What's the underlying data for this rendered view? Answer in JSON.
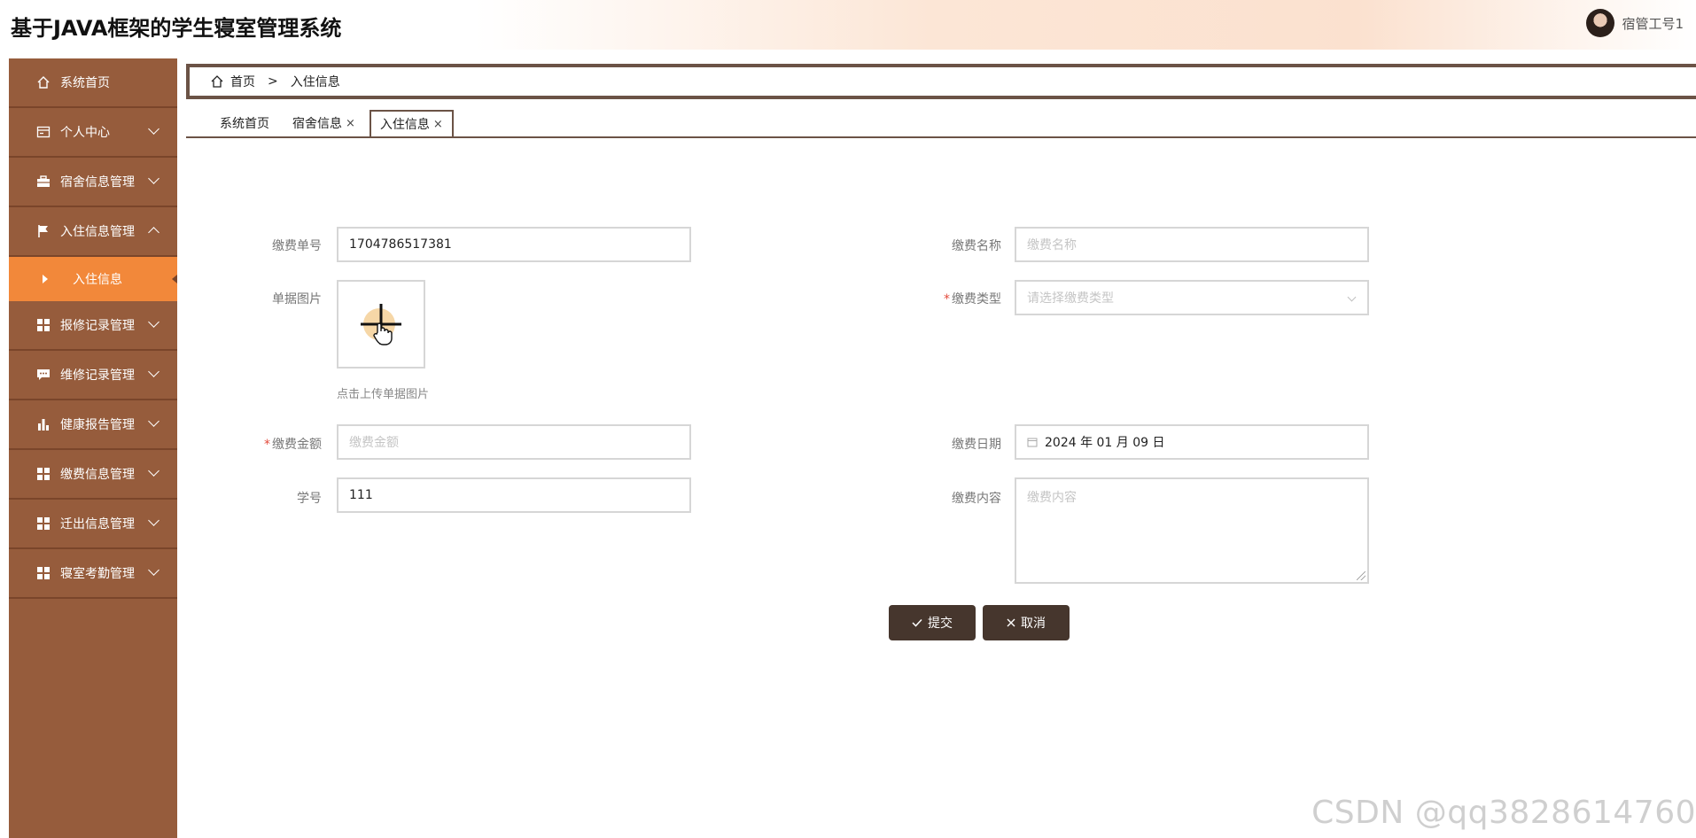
{
  "header": {
    "title": "基于JAVA框架的学生寝室管理系统",
    "user_name": "宿管工号1"
  },
  "sidebar": {
    "items": [
      {
        "label": "系统首页",
        "icon": "home-icon"
      },
      {
        "label": "个人中心",
        "icon": "id-card-icon"
      },
      {
        "label": "宿舍信息管理",
        "icon": "briefcase-icon"
      },
      {
        "label": "入住信息管理",
        "icon": "flag-icon"
      },
      {
        "label": "报修记录管理",
        "icon": "grid-icon"
      },
      {
        "label": "维修记录管理",
        "icon": "chat-icon"
      },
      {
        "label": "健康报告管理",
        "icon": "bar-chart-icon"
      },
      {
        "label": "缴费信息管理",
        "icon": "grid-icon"
      },
      {
        "label": "迁出信息管理",
        "icon": "grid-icon"
      },
      {
        "label": "寝室考勤管理",
        "icon": "grid-icon"
      }
    ],
    "sub_item": "入住信息"
  },
  "breadcrumb": {
    "home": "首页",
    "sep": ">",
    "current": "入住信息"
  },
  "tabs": [
    {
      "label": "系统首页"
    },
    {
      "label": "宿舍信息",
      "close": "×"
    },
    {
      "label": "入住信息",
      "close": "×"
    }
  ],
  "form": {
    "order_no": {
      "label": "缴费单号",
      "value": "1704786517381"
    },
    "fee_name": {
      "label": "缴费名称",
      "placeholder": "缴费名称"
    },
    "receipt_image": {
      "label": "单据图片",
      "hint": "点击上传单据图片"
    },
    "fee_type": {
      "label": "缴费类型",
      "placeholder": "请选择缴费类型",
      "required": "*"
    },
    "amount": {
      "label": "缴费金额",
      "placeholder": "缴费金额",
      "required": "*"
    },
    "fee_date": {
      "label": "缴费日期",
      "value": "2024 年 01 月 09 日"
    },
    "student_no": {
      "label": "学号",
      "value": "111"
    },
    "fee_content": {
      "label": "缴费内容",
      "placeholder": "缴费内容"
    },
    "submit_label": "提交",
    "cancel_label": "取消"
  },
  "watermark": "CSDN @qq3828614760",
  "colors": {
    "sidebar": "#965c3c",
    "active": "#f2883a",
    "button": "#46362d"
  }
}
